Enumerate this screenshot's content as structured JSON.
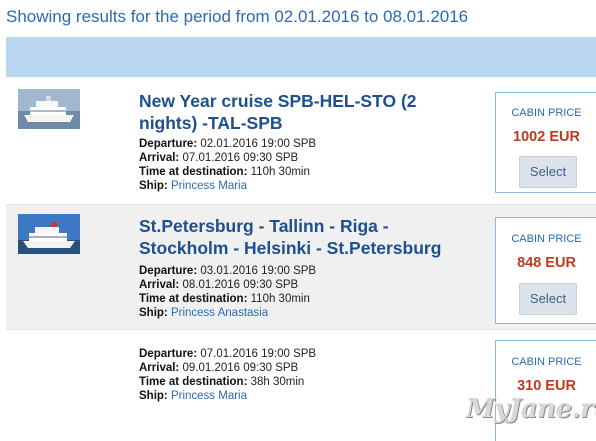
{
  "heading": "Showing results for the period from 02.01.2016 to 08.01.2016",
  "results": [
    {
      "title_line1": "New Year cruise SPB-HEL-STO (2",
      "title_line2": "nights) -TAL-SPB",
      "departure_label": "Departure:",
      "departure_value": "02.01.2016 19:00 SPB",
      "arrival_label": "Arrival:",
      "arrival_value": "07.01.2016 09:30 SPB",
      "time_label": "Time at destination:",
      "time_value": "110h 30min",
      "ship_label": "Ship:",
      "ship_value": "Princess Maria",
      "price_label": "CABIN PRICE",
      "price": "1002 EUR",
      "select_label": "Select"
    },
    {
      "title_line1": "St.Petersburg - Tallinn - Riga -",
      "title_line2": "Stockholm - Helsinki - St.Petersburg",
      "departure_label": "Departure:",
      "departure_value": "03.01.2016 19:00 SPB",
      "arrival_label": "Arrival:",
      "arrival_value": "08.01.2016 09:30 SPB",
      "time_label": "Time at destination:",
      "time_value": "110h 30min",
      "ship_label": "Ship:",
      "ship_value": "Princess Anastasia",
      "price_label": "CABIN PRICE",
      "price": "848 EUR",
      "select_label": "Select"
    },
    {
      "departure_label": "Departure:",
      "departure_value": "07.01.2016 19:00 SPB",
      "arrival_label": "Arrival:",
      "arrival_value": "09.01.2016 09:30 SPB",
      "time_label": "Time at destination:",
      "time_value": "38h 30min",
      "ship_label": "Ship:",
      "ship_value": "Princess Maria",
      "price_label": "CABIN PRICE",
      "price": "310 EUR"
    }
  ],
  "watermark": "MyJane.ru"
}
